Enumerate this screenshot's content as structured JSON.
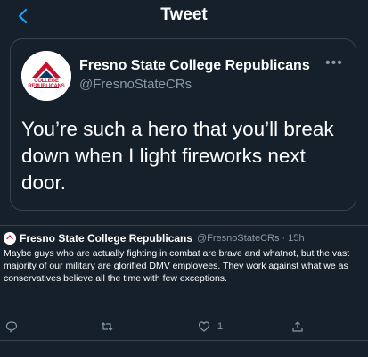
{
  "header": {
    "title": "Tweet",
    "back_icon": "back-arrow-icon"
  },
  "quoted_tweet": {
    "avatar_text": "COLLEGE REPUBLICANS",
    "display_name": "Fresno State College Republicans",
    "handle": "@FresnoStateCRs",
    "text": "You’re such a hero that you’ll break down when I light fireworks next door.",
    "more_icon": "more-options-icon"
  },
  "tweet": {
    "display_name": "Fresno State College Republicans",
    "handle_time": "@FresnoStateCRs · 15h",
    "text": "Maybe guys who are actually fighting in combat are brave and whatnot, but the vast majority of our military are glorified DMV employees. They work against what we as conservatives believe all the time with few exceptions.",
    "actions": {
      "reply_icon": "reply-icon",
      "retweet_icon": "retweet-icon",
      "like_icon": "like-icon",
      "like_count": "1",
      "share_icon": "share-icon"
    }
  },
  "colors": {
    "background": "#15202b",
    "accent": "#1da1f2",
    "muted": "#8899a6",
    "border": "#38444d",
    "brand_red": "#c8102e",
    "brand_blue": "#003a70"
  }
}
